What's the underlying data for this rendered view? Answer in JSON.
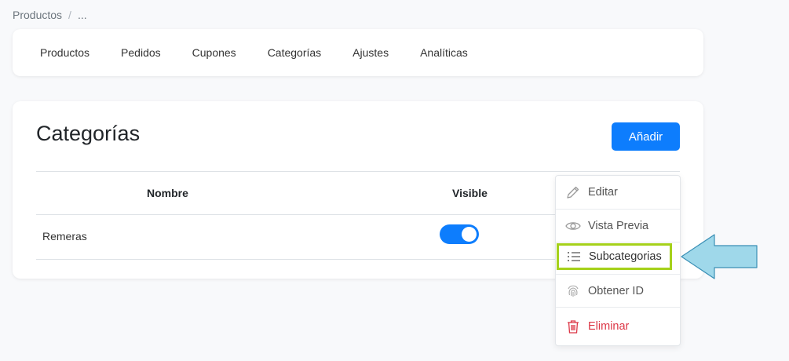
{
  "breadcrumb": {
    "root": "Productos",
    "separator": "/",
    "current": "..."
  },
  "nav": {
    "items": [
      "Productos",
      "Pedidos",
      "Cupones",
      "Categorías",
      "Ajustes",
      "Analíticas"
    ]
  },
  "main": {
    "title": "Categorías",
    "add_label": "Añadir",
    "table": {
      "headers": {
        "name": "Nombre",
        "visible": "Visible"
      },
      "rows": [
        {
          "name": "Remeras",
          "visible": true
        }
      ]
    }
  },
  "menu": {
    "items": [
      {
        "label": "Editar",
        "icon": "pencil-icon"
      },
      {
        "label": "Vista Previa",
        "icon": "eye-icon"
      },
      {
        "label": "Subcategorias",
        "icon": "list-icon",
        "highlighted": true
      },
      {
        "label": "Obtener ID",
        "icon": "fingerprint-icon"
      },
      {
        "label": "Eliminar",
        "icon": "trash-icon",
        "danger": true
      }
    ]
  },
  "colors": {
    "accent": "#0d7dfd",
    "highlight_border": "#a5d11a",
    "danger": "#dc3545",
    "callout_arrow": "#9fd8ea"
  }
}
